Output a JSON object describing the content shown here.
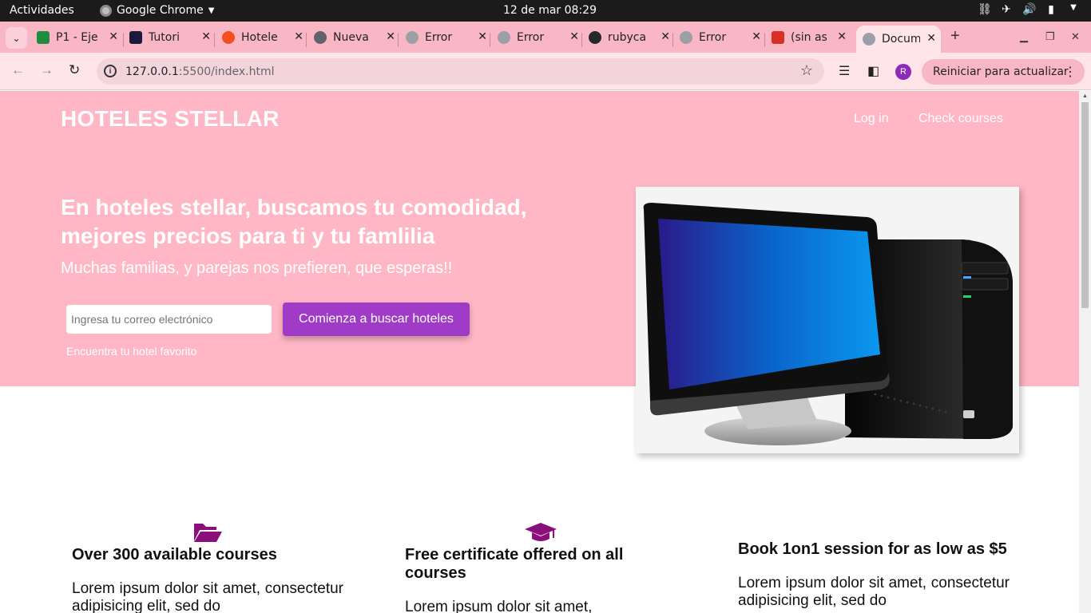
{
  "system_bar": {
    "activities": "Actividades",
    "app_name": "Google Chrome",
    "clock": "12 de mar  08:29"
  },
  "tabs": [
    {
      "title": "P1 - Eje",
      "favicon_color": "#1e8e3e"
    },
    {
      "title": "Tutori",
      "favicon_color": "#1a1a3a"
    },
    {
      "title": "Hotele",
      "favicon_color": "#f24e1e"
    },
    {
      "title": "Nueva",
      "favicon_color": "#5f6368"
    },
    {
      "title": "Error",
      "favicon_color": "#9aa0a6"
    },
    {
      "title": "Error",
      "favicon_color": "#9aa0a6"
    },
    {
      "title": "rubyca",
      "favicon_color": "#24292e"
    },
    {
      "title": "Error",
      "favicon_color": "#9aa0a6"
    },
    {
      "title": "(sin as",
      "favicon_color": "#d93025"
    },
    {
      "title": "Docum",
      "favicon_color": "#9aa0a6",
      "active": true
    }
  ],
  "address_bar": {
    "host": "127.0.0.1",
    "path": ":5500/index.html"
  },
  "profile_initial": "R",
  "restart_label": "Reiniciar para actualizar",
  "page": {
    "brand": "HOTELES STELLAR",
    "nav": [
      "Log in",
      "Check courses"
    ],
    "headline": "En hoteles stellar, buscamos tu comodidad, mejores precios para ti y tu famlilia",
    "subheadline": "Muchas familias, y parejas nos prefieren, que esperas!!",
    "email_placeholder": "Ingresa tu correo electrónico",
    "cta_label": "Comienza a buscar hoteles",
    "hint": "Encuentra tu hotel favorito",
    "features": [
      {
        "icon": "folder-open-icon",
        "title": "Over 300 available courses",
        "text": "Lorem ipsum dolor sit amet, consectetur adipisicing elit, sed do"
      },
      {
        "icon": "graduation-cap-icon",
        "title": "Free certificate offered on all courses",
        "text": "Lorem ipsum dolor sit amet,"
      },
      {
        "icon": "none",
        "title": "Book 1on1 session for as low as $5",
        "text": "Lorem ipsum dolor sit amet, consectetur adipisicing elit, sed do"
      }
    ]
  },
  "colors": {
    "hero_bg": "#ffb7c5",
    "cta_bg": "#a03bc7",
    "icon_color": "#8b0f7a",
    "tabstrip_bg": "#f9b7c6"
  }
}
